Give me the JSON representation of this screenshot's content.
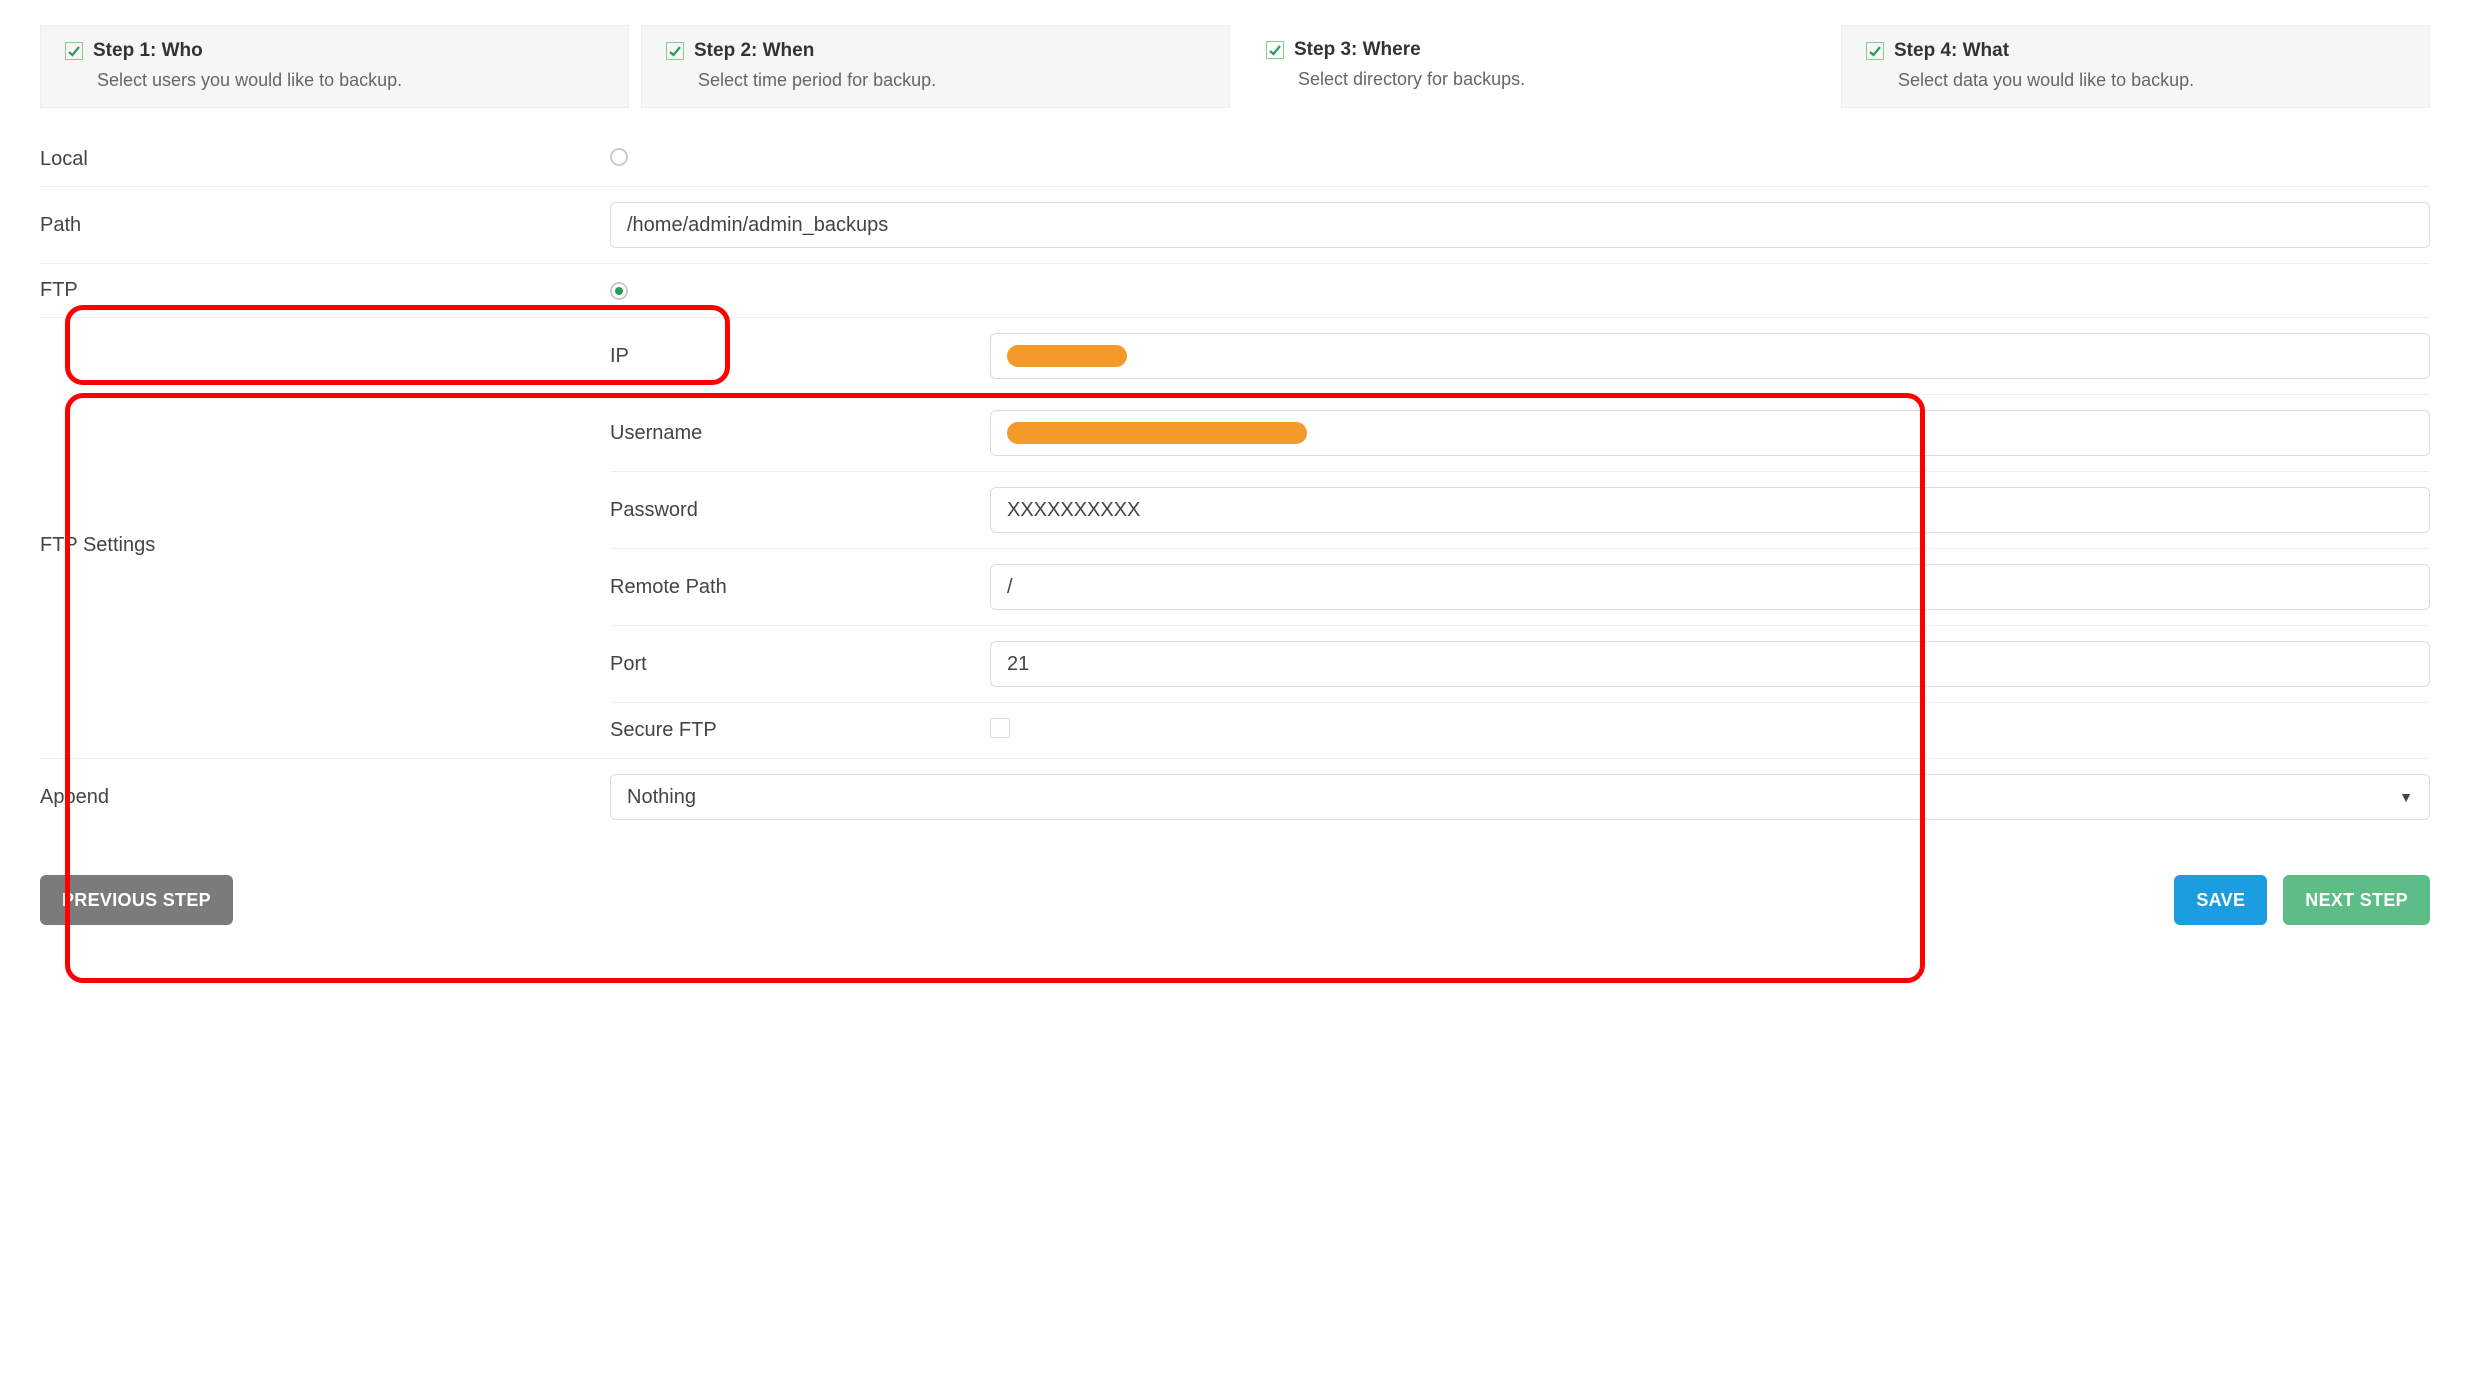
{
  "steps": [
    {
      "title": "Step 1: Who",
      "subtitle": "Select users you would like to backup."
    },
    {
      "title": "Step 2: When",
      "subtitle": "Select time period for backup."
    },
    {
      "title": "Step 3: Where",
      "subtitle": "Select directory for backups."
    },
    {
      "title": "Step 4: What",
      "subtitle": "Select data you would like to backup."
    }
  ],
  "form": {
    "local_label": "Local",
    "local_selected": false,
    "path_label": "Path",
    "path_value": "/home/admin/admin_backups",
    "ftp_label": "FTP",
    "ftp_selected": true,
    "ftp_group_label": "FTP Settings",
    "ftp": {
      "ip_label": "IP",
      "ip_value": "",
      "user_label": "Username",
      "user_value": "",
      "pass_label": "Password",
      "pass_value": "XXXXXXXXXX",
      "rpath_label": "Remote Path",
      "rpath_value": "/",
      "port_label": "Port",
      "port_value": "21",
      "sftp_label": "Secure FTP",
      "sftp_checked": false
    },
    "append_label": "Append",
    "append_value": "Nothing"
  },
  "buttons": {
    "prev": "PREVIOUS STEP",
    "save": "SAVE",
    "next": "NEXT STEP"
  }
}
